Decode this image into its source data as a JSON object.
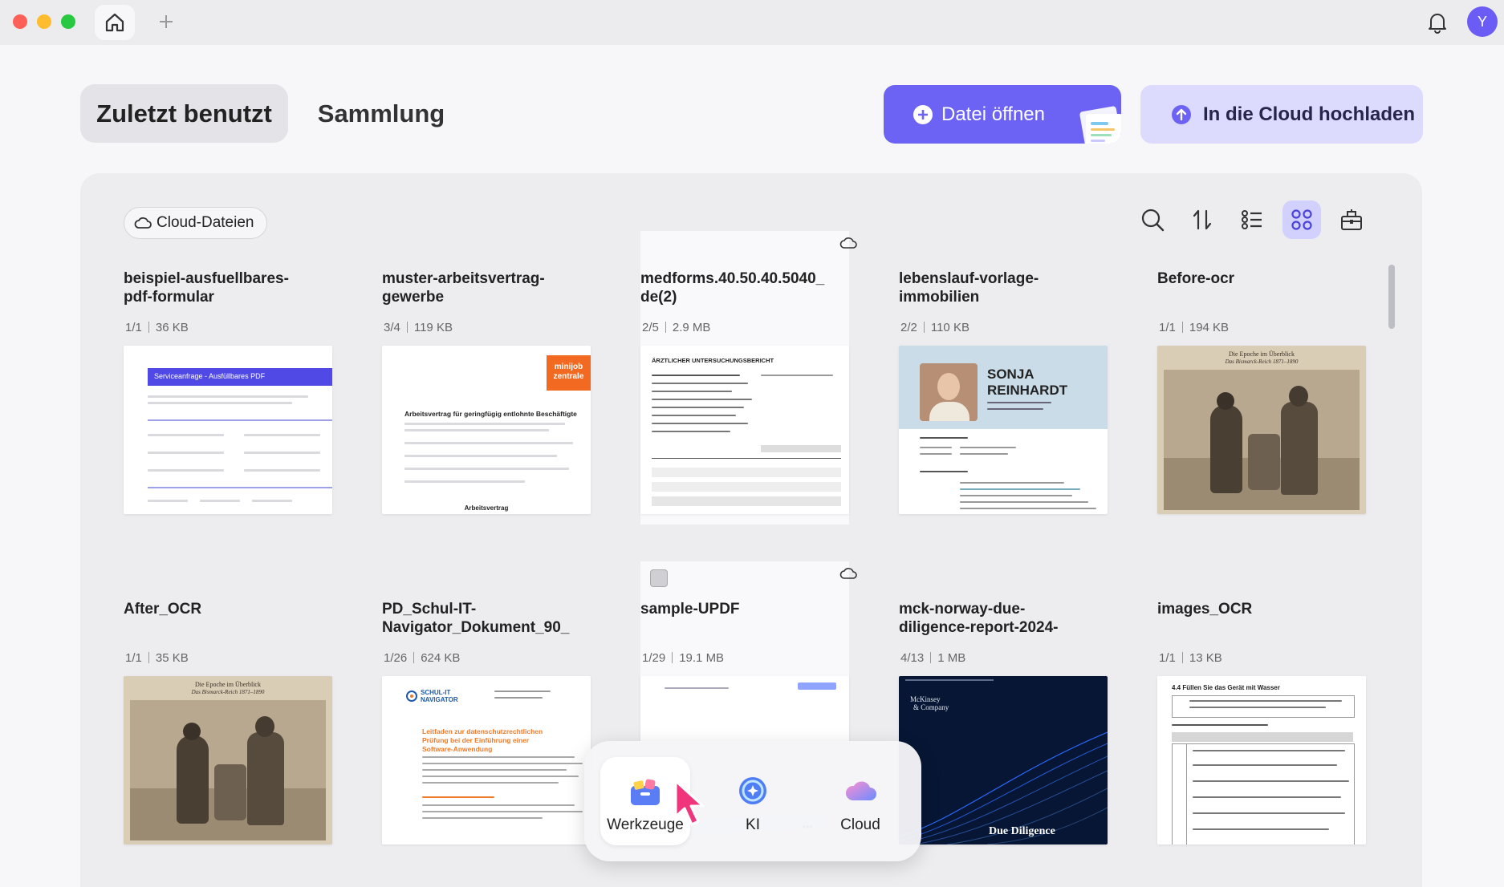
{
  "titlebar": {
    "avatar_letter": "Y",
    "icons": [
      "home-icon",
      "plus-icon",
      "bell-icon"
    ]
  },
  "header": {
    "tabs": [
      {
        "label": "Zuletzt benutzt",
        "active": true
      },
      {
        "label": "Sammlung",
        "active": false
      }
    ],
    "open_button": "Datei öffnen",
    "cloud_button": "In die Cloud hochladen"
  },
  "toolbar": {
    "cloud_files_label": "Cloud-Dateien",
    "icons": [
      "search-icon",
      "sort-icon",
      "list-view-icon",
      "grid-view-icon",
      "toolbox-icon"
    ],
    "selected_view": "grid"
  },
  "files": [
    {
      "title": "beispiel-ausfuellbares-\npdf-formular",
      "pages": "1/1",
      "size": "36 KB",
      "cloud": false
    },
    {
      "title": "muster-arbeitsvertrag-\ngewerbe",
      "pages": "3/4",
      "size": "119 KB",
      "cloud": false
    },
    {
      "title": "medforms.40.50.40.5040_\nde(2)",
      "pages": "2/5",
      "size": "2.9 MB",
      "cloud": true
    },
    {
      "title": "lebenslauf-vorlage-\nimmobilien",
      "pages": "2/2",
      "size": "110 KB",
      "cloud": false
    },
    {
      "title": "Before-ocr",
      "pages": "1/1",
      "size": "194 KB",
      "cloud": false
    },
    {
      "title": "After_OCR",
      "pages": "1/1",
      "size": "35 KB",
      "cloud": false
    },
    {
      "title": "PD_Schul-IT-\nNavigator_Dokument_90_",
      "pages": "1/26",
      "size": "624 KB",
      "cloud": false
    },
    {
      "title": "sample-UPDF",
      "pages": "1/29",
      "size": "19.1 MB",
      "cloud": true
    },
    {
      "title": "mck-norway-due-\ndiligence-report-2024-",
      "pages": "4/13",
      "size": "1 MB",
      "cloud": false
    },
    {
      "title": "images_OCR",
      "pages": "1/1",
      "size": "13 KB",
      "cloud": false
    }
  ],
  "thumbnails": {
    "form_header": "Serviceanfrage - Ausfüllbares PDF",
    "contract_badge_1": "minijob",
    "contract_badge_2": "zentrale",
    "contract_heading": "Arbeitsvertrag für geringfügig entlohnte Beschäftigte",
    "contract_footer": "Arbeitsvertrag",
    "med_heading": "ÄRZTLICHER UNTERSUCHUNGSBERICHT",
    "cv_name_1": "SONJA",
    "cv_name_2": "REINHARDT",
    "history_caption_1": "Die Epoche im Überblick",
    "history_caption_2": "Das Bismarck-Reich 1871–1890",
    "schul_logo_1": "SCHUL-IT",
    "schul_logo_2": "NAVIGATOR",
    "schul_heading": "Leitfaden zur datenschutzrechtlichen Prüfung bei der Einführung einer Software-Anwendung",
    "mck_brand_1": "McKinsey",
    "mck_brand_2": "& Company",
    "mck_title": "Due Diligence",
    "ocr_heading": "4.4 Füllen Sie das Gerät mit Wasser"
  },
  "dock": {
    "items": [
      {
        "label": "Werkzeuge"
      },
      {
        "label": "KI"
      },
      {
        "label": "Cloud"
      }
    ]
  },
  "colors": {
    "accent": "#6c63f5",
    "accent_light": "#dcdbfe",
    "background": "#f7f7f9",
    "panel": "#ededf0"
  }
}
